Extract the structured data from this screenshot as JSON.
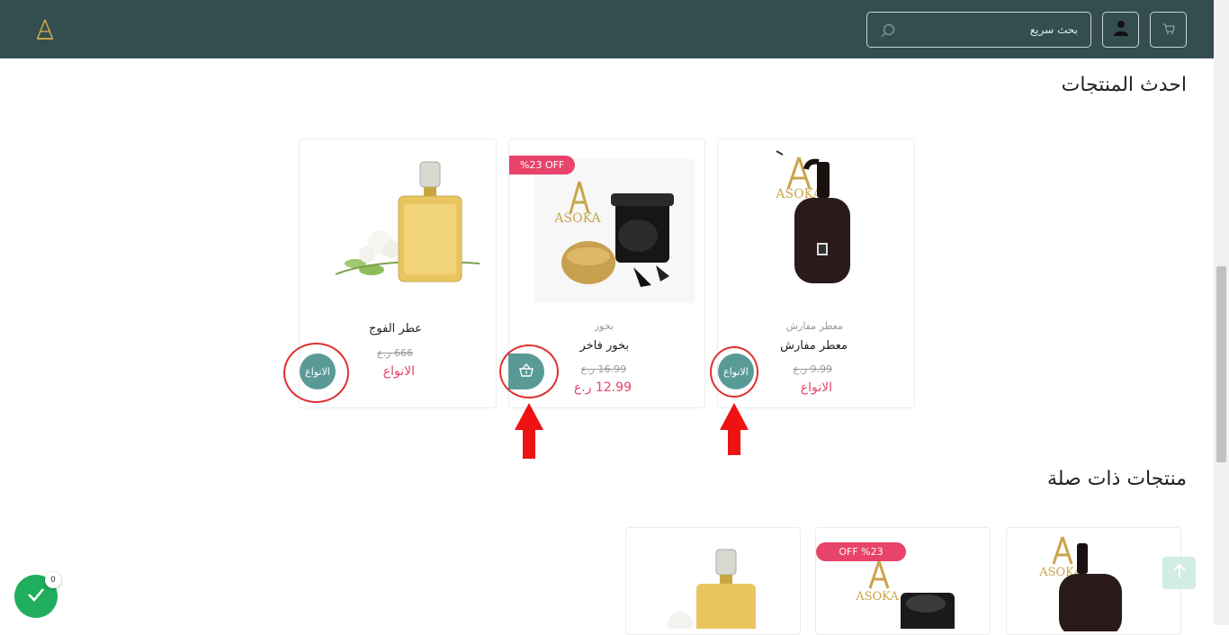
{
  "header": {
    "search_placeholder": "بحث سريع",
    "logo_icon": "asoka-logo",
    "user_icon": "user-icon",
    "cart_icon": "cart-icon",
    "search_icon": "search-icon",
    "bg_color": "#344e4f"
  },
  "latest": {
    "title": "احدث المنتجات",
    "products": [
      {
        "name": "عطر الفوج",
        "old_price": "666 ر.ع",
        "price": "الانواع",
        "button": "الانواع"
      },
      {
        "badge": "%23 OFF",
        "category": "بخور",
        "name": "بخور فاخر",
        "old_price": "16.99 ر.ع",
        "price": "12.99 ر.ع",
        "button_icon": "basket-icon"
      },
      {
        "category": "معطر مفارش",
        "name": "معطر مفارش",
        "old_price": "9.99 ر.ع",
        "price": "الانواع",
        "button": "الانواع"
      }
    ]
  },
  "related": {
    "title": "منتجات ذات صلة",
    "badge": "OFF %23"
  },
  "cart_widget": {
    "count": "0"
  },
  "colors": {
    "accent": "#5a9a96",
    "price": "#e8436a",
    "annotation": "#e03030",
    "success": "#1fae5d"
  }
}
